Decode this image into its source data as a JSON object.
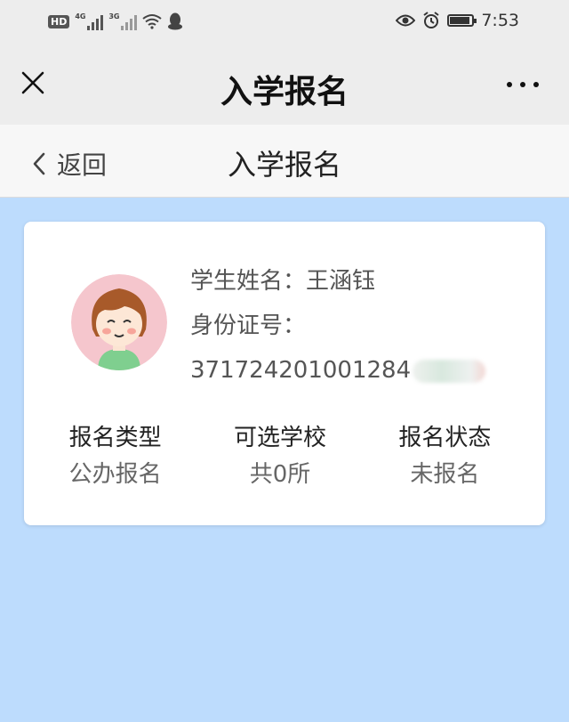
{
  "status_bar": {
    "hd_badge": "HD",
    "sim1": "4G",
    "sim2": "3G",
    "time": "7:53",
    "icons": [
      "hd-icon",
      "signal-icon",
      "wifi-icon",
      "qq-icon",
      "eye-icon",
      "alarm-icon",
      "battery-icon"
    ]
  },
  "navbar": {
    "title": "入学报名",
    "close_icon": "close-icon",
    "more_icon": "more-icon"
  },
  "subheader": {
    "back_label": "返回",
    "title": "入学报名"
  },
  "student": {
    "name_label": "学生姓名：",
    "name": "王涵钰",
    "id_label": "身份证号：",
    "id_number": "371724201001284"
  },
  "stats": [
    {
      "label": "报名类型",
      "value": "公办报名"
    },
    {
      "label": "可选学校",
      "value": "共0所"
    },
    {
      "label": "报名状态",
      "value": "未报名"
    }
  ],
  "colors": {
    "background": "#bddcfd",
    "avatar_bg": "#f5c6cd"
  }
}
